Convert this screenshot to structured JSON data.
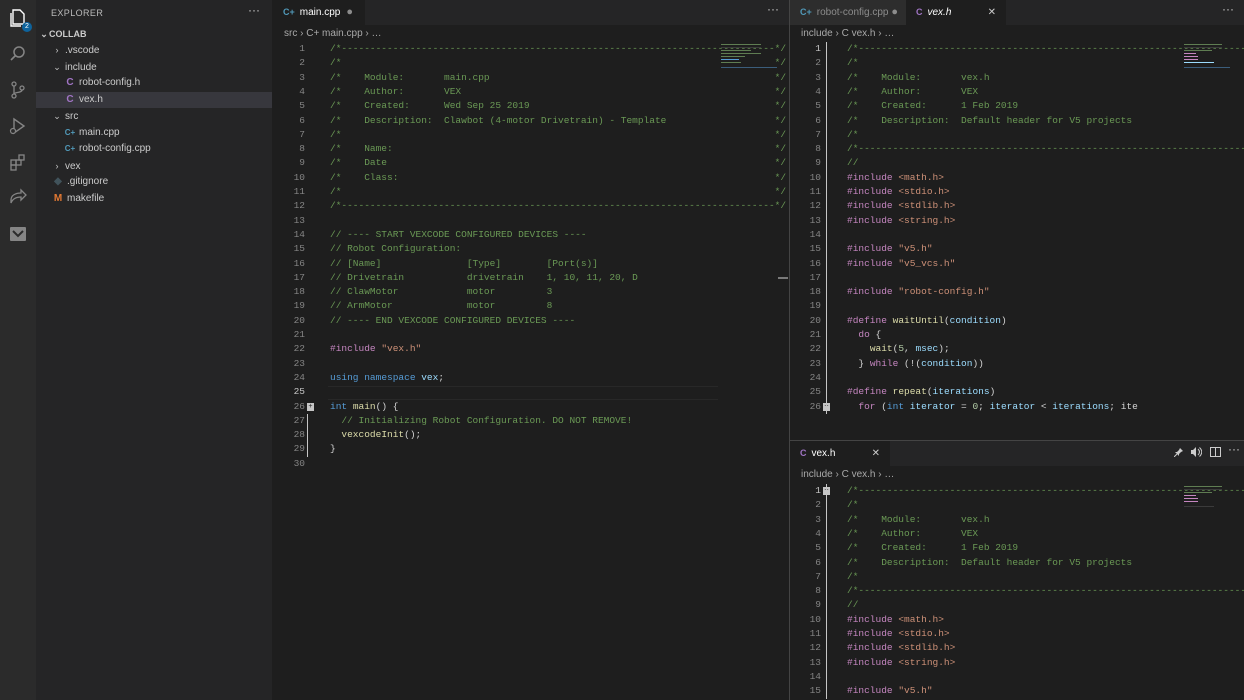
{
  "activity_bar": {
    "explorer_badge": "2"
  },
  "sidebar": {
    "title": "EXPLORER",
    "more": "···",
    "root_label": "COLLAB",
    "tree": [
      {
        "label": ".vscode",
        "kind": "folder",
        "expanded": false
      },
      {
        "label": "include",
        "kind": "folder",
        "expanded": true
      },
      {
        "label": "robot-config.h",
        "kind": "c"
      },
      {
        "label": "vex.h",
        "kind": "c",
        "selected": true
      },
      {
        "label": "src",
        "kind": "folder",
        "expanded": true
      },
      {
        "label": "main.cpp",
        "kind": "cpp"
      },
      {
        "label": "robot-config.cpp",
        "kind": "cpp"
      },
      {
        "label": "vex",
        "kind": "folder",
        "expanded": false
      },
      {
        "label": ".gitignore",
        "kind": "git"
      },
      {
        "label": "makefile",
        "kind": "make"
      }
    ]
  },
  "icons": {
    "c": "C",
    "cpp": "C+",
    "git": "◆",
    "make": "M",
    "chev_right": "›",
    "chev_down": "⌄",
    "close": "✕",
    "dot": "●"
  },
  "left_editor": {
    "tab_label": "main.cpp",
    "breadcrumb": "src  ›  C+ main.cpp  ›  …",
    "more": "···",
    "lines": [
      "/*----------------------------------------------------------------------------*/",
      "/*                                                                            */",
      "/*    Module:       main.cpp                                                  */",
      "/*    Author:       VEX                                                       */",
      "/*    Created:      Wed Sep 25 2019                                           */",
      "/*    Description:  Clawbot (4-motor Drivetrain) - Template                   */",
      "/*                                                                            */",
      "/*    Name:                                                                   */",
      "/*    Date                                                                    */",
      "/*    Class:                                                                  */",
      "/*                                                                            */",
      "/*----------------------------------------------------------------------------*/",
      "",
      "// ---- START VEXCODE CONFIGURED DEVICES ----",
      "// Robot Configuration:",
      "// [Name]               [Type]        [Port(s)]",
      "// Drivetrain           drivetrain    1, 10, 11, 20, D",
      "// ClawMotor            motor         3",
      "// ArmMotor             motor         8",
      "// ---- END VEXCODE CONFIGURED DEVICES ----",
      "",
      "#include \"vex.h\"",
      "",
      "using namespace vex;",
      "",
      "int main() {",
      "  // Initializing Robot Configuration. DO NOT REMOVE!",
      "  vexcodeInit();",
      "}",
      ""
    ]
  },
  "right_top_editor": {
    "tab1_label": "robot-config.cpp",
    "tab2_label": "vex.h",
    "breadcrumb": "include  ›  C vex.h  ›  …",
    "more": "···",
    "lines": [
      "/*----------------------------------------------------------------------------*/",
      "/*                                                                            */",
      "/*    Module:       vex.h                                                     */",
      "/*    Author:       VEX                                                       */",
      "/*    Created:      1 Feb 2019                                                */",
      "/*    Description:  Default header for V5 projects                            */",
      "/*                                                                            */",
      "/*----------------------------------------------------------------------------*/",
      "//",
      "#include <math.h>",
      "#include <stdio.h>",
      "#include <stdlib.h>",
      "#include <string.h>",
      "",
      "#include \"v5.h\"",
      "#include \"v5_vcs.h\"",
      "",
      "#include \"robot-config.h\"",
      "",
      "#define waitUntil(condition)                                                   \\",
      "  do {                                                                         \\",
      "    wait(5, msec);                                                             \\",
      "  } while (!(condition))",
      "",
      "#define repeat(iterations)                                                     \\",
      "  for (int iterator = 0; iterator < iterations; ite"
    ]
  },
  "right_bottom_editor": {
    "tab_label": "vex.h",
    "breadcrumb": "include  ›  C vex.h  ›  …",
    "lines": [
      "/*----------------------------------------------------------------------------*/",
      "/*                                                                            */",
      "/*    Module:       vex.h                                                     */",
      "/*    Author:       VEX                                                       */",
      "/*    Created:      1 Feb 2019                                                */",
      "/*    Description:  Default header for V5 projects                            */",
      "/*                                                                            */",
      "/*----------------------------------------------------------------------------*/",
      "//",
      "#include <math.h>",
      "#include <stdio.h>",
      "#include <stdlib.h>",
      "#include <string.h>",
      "",
      "#include \"v5.h\""
    ]
  }
}
